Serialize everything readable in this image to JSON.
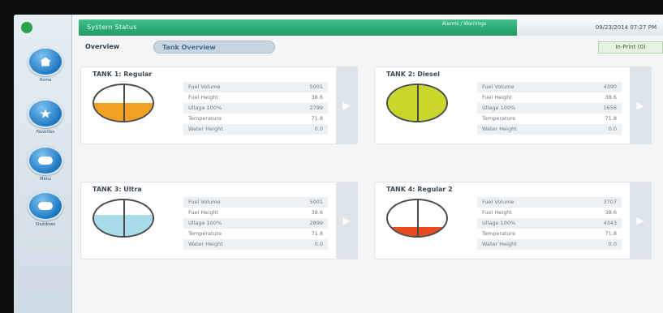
{
  "header": {
    "title": "System Status",
    "alarm_label": "Alarms / Warnings",
    "datetime": "09/23/2014 07:27 PM"
  },
  "sidebar": {
    "items": [
      {
        "label": "Home",
        "icon": "home-icon"
      },
      {
        "label": "Favorites",
        "icon": "star-icon"
      },
      {
        "label": "Menu",
        "icon": "menu-icon"
      },
      {
        "label": "Shutdown",
        "icon": "shutdown-icon"
      }
    ]
  },
  "tabs": {
    "overview": "Overview",
    "active": "Tank Overview",
    "print": "In-Print (0)"
  },
  "tanks": [
    {
      "title": "TANK 1: Regular",
      "fill_color": "#f2a024",
      "fill_level": 0.5,
      "rows": [
        {
          "label": "Fuel Volume",
          "value": "5001"
        },
        {
          "label": "Fuel Height",
          "value": "38.6"
        },
        {
          "label": "Ullage 100%",
          "value": "2799"
        },
        {
          "label": "Temperature",
          "value": "71.8"
        },
        {
          "label": "Water Height",
          "value": "0.0"
        }
      ]
    },
    {
      "title": "TANK 2: Diesel",
      "fill_color": "#c8d72a",
      "fill_level": 1.0,
      "rows": [
        {
          "label": "Fuel Volume",
          "value": "4390"
        },
        {
          "label": "Fuel Height",
          "value": "38.6"
        },
        {
          "label": "Ullage 100%",
          "value": "1656"
        },
        {
          "label": "Temperature",
          "value": "71.8"
        },
        {
          "label": "Water Height",
          "value": "0.0"
        }
      ]
    },
    {
      "title": "TANK 3: Ultra",
      "fill_color": "#a9dcea",
      "fill_level": 0.6,
      "rows": [
        {
          "label": "Fuel Volume",
          "value": "5001"
        },
        {
          "label": "Fuel Height",
          "value": "38.6"
        },
        {
          "label": "Ullage 100%",
          "value": "2899"
        },
        {
          "label": "Temperature",
          "value": "71.8"
        },
        {
          "label": "Water Height",
          "value": "0.0"
        }
      ]
    },
    {
      "title": "TANK 4: Regular 2",
      "fill_color": "#e84a1c",
      "fill_level": 0.25,
      "rows": [
        {
          "label": "Fuel Volume",
          "value": "3707"
        },
        {
          "label": "Fuel Height",
          "value": "38.6"
        },
        {
          "label": "Ullage 100%",
          "value": "4343"
        },
        {
          "label": "Temperature",
          "value": "71.8"
        },
        {
          "label": "Water Height",
          "value": "0.0"
        }
      ]
    }
  ]
}
